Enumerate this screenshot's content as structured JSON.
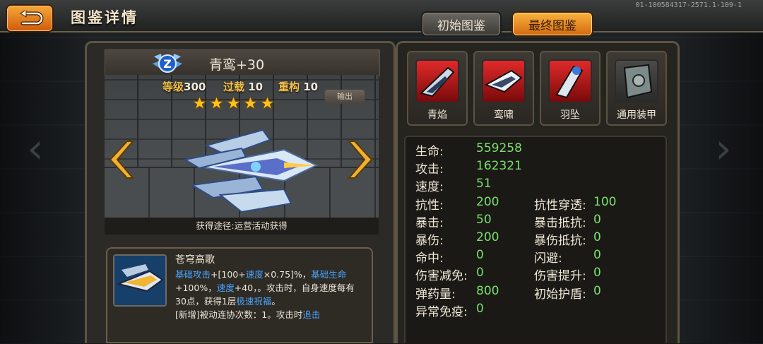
{
  "header": {
    "title": "图鉴详情",
    "version": "01-100584317-2571.1-109-1",
    "tabs": [
      {
        "label": "初始图鉴",
        "active": false
      },
      {
        "label": "最终图鉴",
        "active": true
      }
    ]
  },
  "ship": {
    "name": "青鸾+30",
    "rank_badge": "Z",
    "level_label": "等级",
    "level": "300",
    "overload_label": "过载",
    "overload": "10",
    "rebuild_label": "重构",
    "rebuild": "10",
    "stars": 5,
    "output_label": "输出",
    "source": "获得途径:运营活动获得"
  },
  "skill": {
    "title": "苍穹高歌",
    "desc_parts": [
      {
        "text": "基础攻击",
        "hl": true
      },
      {
        "text": "+[100+",
        "hl": false
      },
      {
        "text": "速度",
        "hl": true
      },
      {
        "text": "×0.75]%，",
        "hl": false
      },
      {
        "text": "基础生命",
        "hl": true
      },
      {
        "text": "+100%，",
        "hl": false
      },
      {
        "text": "速度",
        "hl": true
      },
      {
        "text": "+40，。攻击时，自身速度每有30点，获得1层",
        "hl": false
      },
      {
        "text": "极速祝福",
        "hl": true
      },
      {
        "text": "。",
        "hl": false
      },
      {
        "text": "[新增]被动连协次数：1。攻击时",
        "hl": false
      },
      {
        "text": "追击",
        "hl": true
      }
    ]
  },
  "equipment": [
    {
      "label": "青焰",
      "icon": "red-blade-icon"
    },
    {
      "label": "鸾啸",
      "icon": "red-wing-icon"
    },
    {
      "label": "羽坠",
      "icon": "red-pod-icon"
    },
    {
      "label": "通用装甲",
      "icon": "armor-plate-icon"
    }
  ],
  "stats": {
    "left": [
      {
        "label": "生命:",
        "value": "559258"
      },
      {
        "label": "攻击:",
        "value": "162321"
      },
      {
        "label": "速度:",
        "value": "51"
      },
      {
        "label": "抗性:",
        "value": "200"
      },
      {
        "label": "暴击:",
        "value": "50"
      },
      {
        "label": "暴伤:",
        "value": "200"
      },
      {
        "label": "命中:",
        "value": "0"
      },
      {
        "label": "伤害减免:",
        "value": "0"
      },
      {
        "label": "弹药量:",
        "value": "800"
      },
      {
        "label": "异常免疫:",
        "value": "0"
      }
    ],
    "right": [
      {
        "label": "抗性穿透:",
        "value": "100"
      },
      {
        "label": "暴击抵抗:",
        "value": "0"
      },
      {
        "label": "暴伤抵抗:",
        "value": "0"
      },
      {
        "label": "闪避:",
        "value": "0"
      },
      {
        "label": "伤害提升:",
        "value": "0"
      },
      {
        "label": "初始护盾:",
        "value": "0"
      }
    ]
  },
  "colors": {
    "accent_orange": "#e98a1f",
    "stat_value_green": "#7be06a",
    "skill_highlight_blue": "#4aa5ff",
    "star_gold": "#ffc21c"
  }
}
